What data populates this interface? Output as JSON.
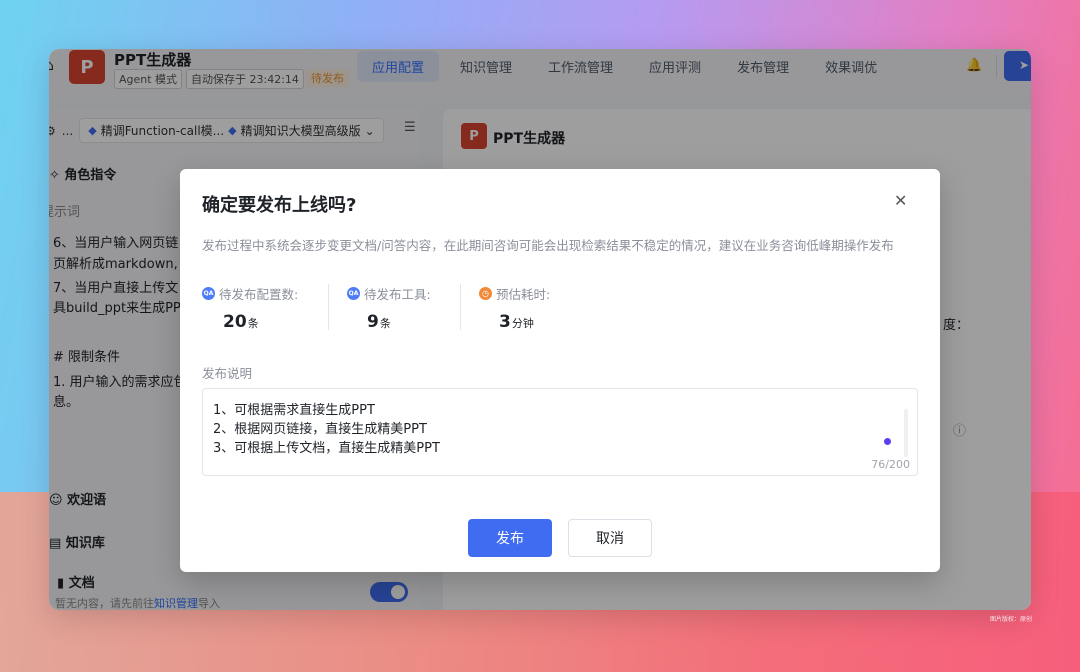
{
  "header": {
    "app_name": "PPT生成器",
    "logo_text": "P",
    "mode_badge": "Agent 模式",
    "autosave": "自动保存于 23:42:14",
    "status_badge": "待发布",
    "tabs": [
      {
        "label": "应用配置",
        "active": true
      },
      {
        "label": "知识管理"
      },
      {
        "label": "工作流管理"
      },
      {
        "label": "应用评测"
      },
      {
        "label": "发布管理"
      },
      {
        "label": "效果调优"
      }
    ]
  },
  "left": {
    "dots": "...",
    "model_1": "精调Function-call模...",
    "model_2": "精调知识大模型高级版",
    "role_section": "角色指令",
    "prompt_label": "提示词",
    "text_lines": [
      "6、当用户输入网页链",
      "页解析成markdown,",
      "7、当用户直接上传文",
      "具build_ppt来生成PPT",
      "# 限制条件",
      "1. 用户输入的需求应包",
      "息。"
    ],
    "welcome_section": "欢迎语",
    "kb_section": "知识库",
    "doc_section": "文档",
    "doc_hint_prefix": "暂无内容，请先前往",
    "doc_hint_link": "知识管理",
    "doc_hint_suffix": "导入"
  },
  "right": {
    "app_name": "PPT生成器",
    "logo_text": "P",
    "fragment": "度："
  },
  "modal": {
    "title": "确定要发布上线吗?",
    "description": "发布过程中系统会逐步变更文档/问答内容，在此期间咨询可能会出现检索结果不稳定的情况，建议在业务咨询低峰期操作发布",
    "stats": [
      {
        "icon": "qa-icon",
        "label": "待发布配置数:",
        "value": "20",
        "unit": "条"
      },
      {
        "icon": "qa-icon",
        "label": "待发布工具:",
        "value": "9",
        "unit": "条"
      },
      {
        "icon": "clock-icon",
        "label": "预估耗时:",
        "value": "3",
        "unit": "分钟"
      }
    ],
    "notes_label": "发布说明",
    "notes_lines": [
      "1、可根据需求直接生成PPT",
      "2、根据网页链接，直接生成精美PPT",
      "3、可根据上传文档，直接生成精美PPT"
    ],
    "char_count": "76/200",
    "publish_button": "发布",
    "cancel_button": "取消"
  },
  "watermark": "图片版权：原创"
}
